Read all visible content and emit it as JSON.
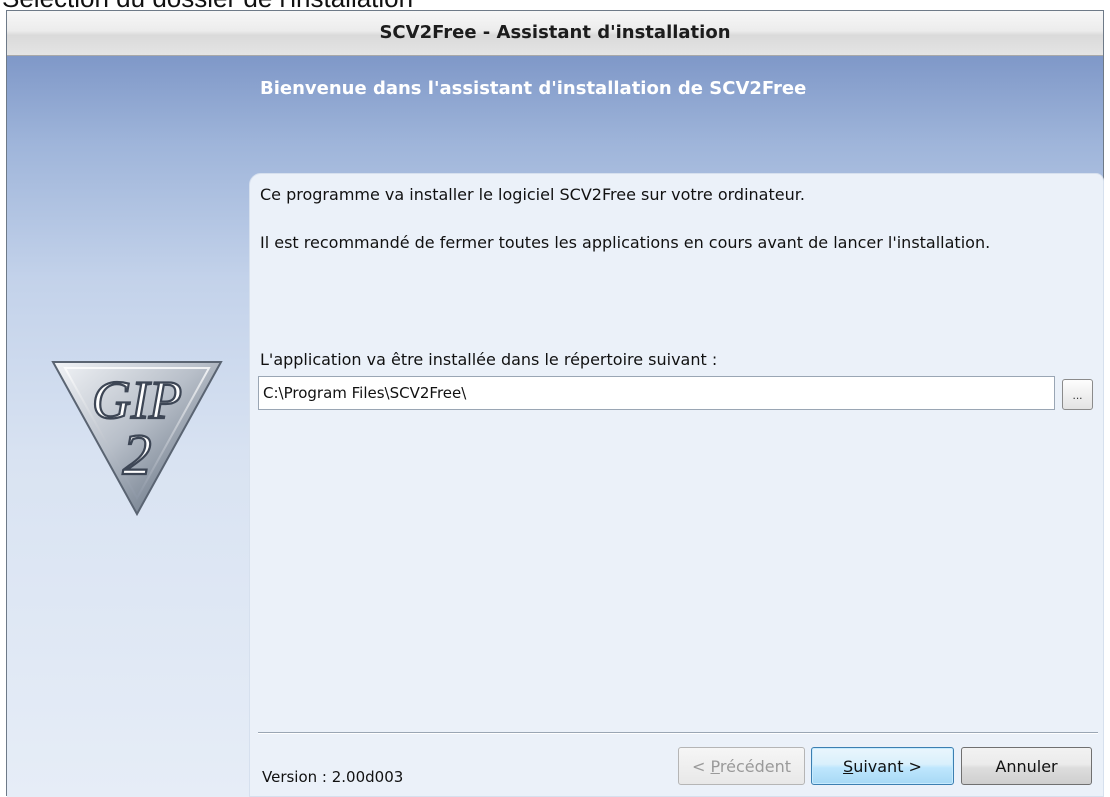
{
  "background_caption": "Sélection du dossier de l'installation",
  "window": {
    "title": "SCV2Free - Assistant d'installation"
  },
  "header": {
    "welcome": "Bienvenue dans l'assistant d'installation de SCV2Free"
  },
  "logo": {
    "text_top": "GIP",
    "text_bottom": "2"
  },
  "content": {
    "line1": "Ce programme va installer le logiciel SCV2Free sur votre ordinateur.",
    "line2": "Il est recommandé de fermer toutes les applications en cours avant de lancer l'installation.",
    "dir_label": "L'application va être installée dans le répertoire suivant :",
    "dir_value": "C:\\Program Files\\SCV2Free\\",
    "browse_label": "..."
  },
  "footer": {
    "version": "Version : 2.00d003",
    "prev_button": {
      "mnemonic": "P",
      "rest": "récédent",
      "prefix": "< ",
      "enabled": false
    },
    "next_button": {
      "mnemonic": "S",
      "rest": "uivant",
      "suffix": " >",
      "default": true
    },
    "cancel_button": "Annuler"
  },
  "colors": {
    "header_gradient_top": "#7f98c8",
    "panel_bg": "#ebf1f9",
    "next_button_accent": "#bee6fd"
  }
}
